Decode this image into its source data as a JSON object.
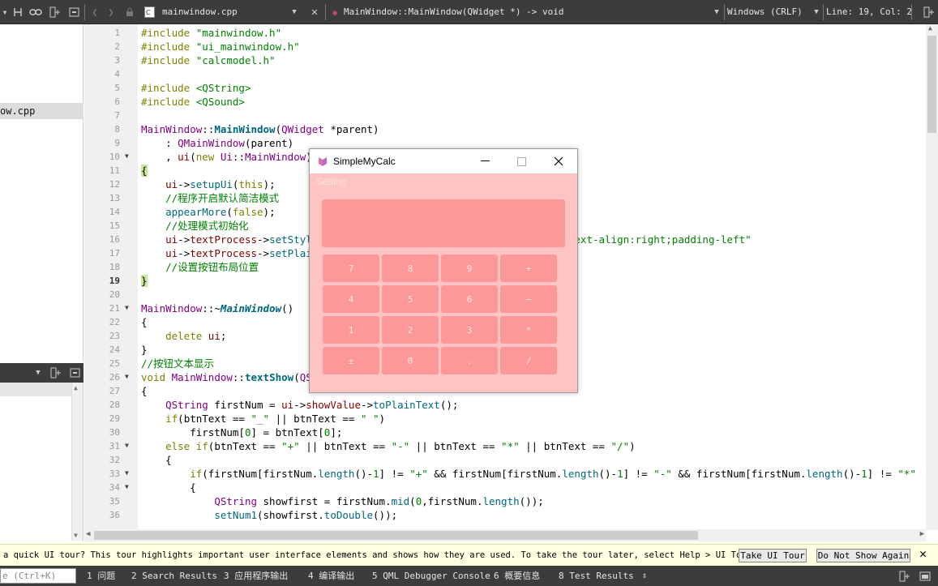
{
  "toolbar": {
    "file_name": "mainwindow.cpp",
    "symbol": "MainWindow::MainWindow(QWidget *) -> void",
    "line_ending": "Windows (CRLF)",
    "position": "Line: 19, Col: 2"
  },
  "left_panel": {
    "selected_file": "ow.cpp"
  },
  "editor": {
    "current_line": 19,
    "lines": [
      {
        "n": 1,
        "html": "<span class='kw'>#include</span> <span class='str'>\"mainwindow.h\"</span>"
      },
      {
        "n": 2,
        "html": "<span class='kw'>#include</span> <span class='str'>\"ui_mainwindow.h\"</span>"
      },
      {
        "n": 3,
        "html": "<span class='kw'>#include</span> <span class='str'>\"calcmodel.h\"</span>"
      },
      {
        "n": 4,
        "html": ""
      },
      {
        "n": 5,
        "html": "<span class='kw'>#include</span> <span class='str'>&lt;QString&gt;</span>"
      },
      {
        "n": 6,
        "html": "<span class='kw'>#include</span> <span class='str'>&lt;QSound&gt;</span>"
      },
      {
        "n": 7,
        "html": ""
      },
      {
        "n": 8,
        "html": "<span class='typ'>MainWindow</span>::<span class='fnb'>MainWindow</span>(<span class='typ'>QWidget</span> *parent)"
      },
      {
        "n": 9,
        "html": "    : <span class='typ'>QMainWindow</span>(parent)"
      },
      {
        "n": 10,
        "html": "    , <span class='mem'>ui</span>(<span class='kw'>new</span> <span class='typ'>Ui</span>::<span class='typ'>MainWindow</span>)"
      },
      {
        "n": 11,
        "html": "<span class='brace-hl'>{</span>"
      },
      {
        "n": 12,
        "html": "    <span class='mem'>ui</span>-&gt;<span class='fn'>setupUi</span>(<span class='kw'>this</span>);"
      },
      {
        "n": 13,
        "html": "    <span class='cm'>//程序开启默认简洁模式</span>"
      },
      {
        "n": 14,
        "html": "    <span class='fn'>appearMore</span>(<span class='kw'>false</span>);"
      },
      {
        "n": 15,
        "html": "    <span class='cm'>//处理模式初始化</span>"
      },
      {
        "n": 16,
        "html": "    <span class='mem'>ui</span>-&gt;<span class='mem'>textProcess</span>-&gt;<span class='fn'>setStyleSheet</span>(<span class='str'>\"background-color:rgb(253,133,133);text-align:right;padding-left\"</span>"
      },
      {
        "n": 17,
        "html": "    <span class='mem'>ui</span>-&gt;<span class='mem'>textProcess</span>-&gt;<span class='fn'>setPlainText</span>(<span class='str'>\"\"</span>);"
      },
      {
        "n": 18,
        "html": "    <span class='cm'>//设置按钮布局位置</span>"
      },
      {
        "n": 19,
        "html": "<span class='brace-hl'>}</span>"
      },
      {
        "n": 20,
        "html": ""
      },
      {
        "n": 21,
        "html": "<span class='typ'>MainWindow</span>::~<span class='fni'>MainWindow</span>()"
      },
      {
        "n": 22,
        "html": "{"
      },
      {
        "n": 23,
        "html": "    <span class='kw'>delete</span> <span class='mem'>ui</span>;"
      },
      {
        "n": 24,
        "html": "}"
      },
      {
        "n": 25,
        "html": "<span class='cm'>//按钮文本显示</span>"
      },
      {
        "n": 26,
        "html": "<span class='kw'>void</span> <span class='typ'>MainWindow</span>::<span class='fnb'>textShow</span>(<span class='typ'>QString</span> btnText)"
      },
      {
        "n": 27,
        "html": "{"
      },
      {
        "n": 28,
        "html": "    <span class='typ'>QString</span> firstNum = <span class='mem'>ui</span>-&gt;<span class='mem'>showValue</span>-&gt;<span class='fn'>toPlainText</span>();"
      },
      {
        "n": 29,
        "html": "    <span class='kw'>if</span>(btnText == <span class='str'>\"_\"</span> || btnText == <span class='str'>\" \"</span>)"
      },
      {
        "n": 30,
        "html": "        firstNum[<span class='str'>0</span>] = btnText[<span class='str'>0</span>];"
      },
      {
        "n": 31,
        "html": "    <span class='kw'>else if</span>(btnText == <span class='str'>\"+\"</span> || btnText == <span class='str'>\"-\"</span> || btnText == <span class='str'>\"*\"</span> || btnText == <span class='str'>\"/\"</span>)"
      },
      {
        "n": 32,
        "html": "    {"
      },
      {
        "n": 33,
        "html": "        <span class='kw'>if</span>(firstNum[firstNum.<span class='fn'>length</span>()-<span class='str'>1</span>] != <span class='str'>\"+\"</span> &amp;&amp; firstNum[firstNum.<span class='fn'>length</span>()-<span class='str'>1</span>] != <span class='str'>\"-\"</span> &amp;&amp; firstNum[firstNum.<span class='fn'>length</span>()-<span class='str'>1</span>] != <span class='str'>\"*\"</span>"
      },
      {
        "n": 34,
        "html": "        {"
      },
      {
        "n": 35,
        "html": "            <span class='typ'>QString</span> showfirst = firstNum.<span class='fn'>mid</span>(<span class='str'>0</span>,firstNum.<span class='fn'>length</span>());"
      },
      {
        "n": 36,
        "html": "            <span class='fn'>setNum1</span>(showfirst.<span class='fn'>toDouble</span>());"
      }
    ]
  },
  "info_bar": {
    "text": "a quick UI tour? This tour highlights important user interface elements and shows how they are used. To take the tour later, select Help > UI Tour.",
    "take_tour_label": "Take UI Tour",
    "dont_show_label": "Do Not Show Again"
  },
  "bottom_bar": {
    "search_placeholder": "e (Ctrl+K)",
    "tabs": [
      "1 问题",
      "2 Search Results",
      "3 应用程序输出",
      "4 编译输出",
      "5 QML Debugger Console",
      "6 概要信息",
      "8 Test Results"
    ]
  },
  "calc": {
    "title": "SimpleMyCalc",
    "menu": "Setting",
    "keys": [
      [
        "7",
        "8",
        "9",
        "+"
      ],
      [
        "4",
        "5",
        "6",
        "−"
      ],
      [
        "1",
        "2",
        "3",
        "*"
      ],
      [
        "±",
        "0",
        ".",
        "/"
      ]
    ]
  }
}
